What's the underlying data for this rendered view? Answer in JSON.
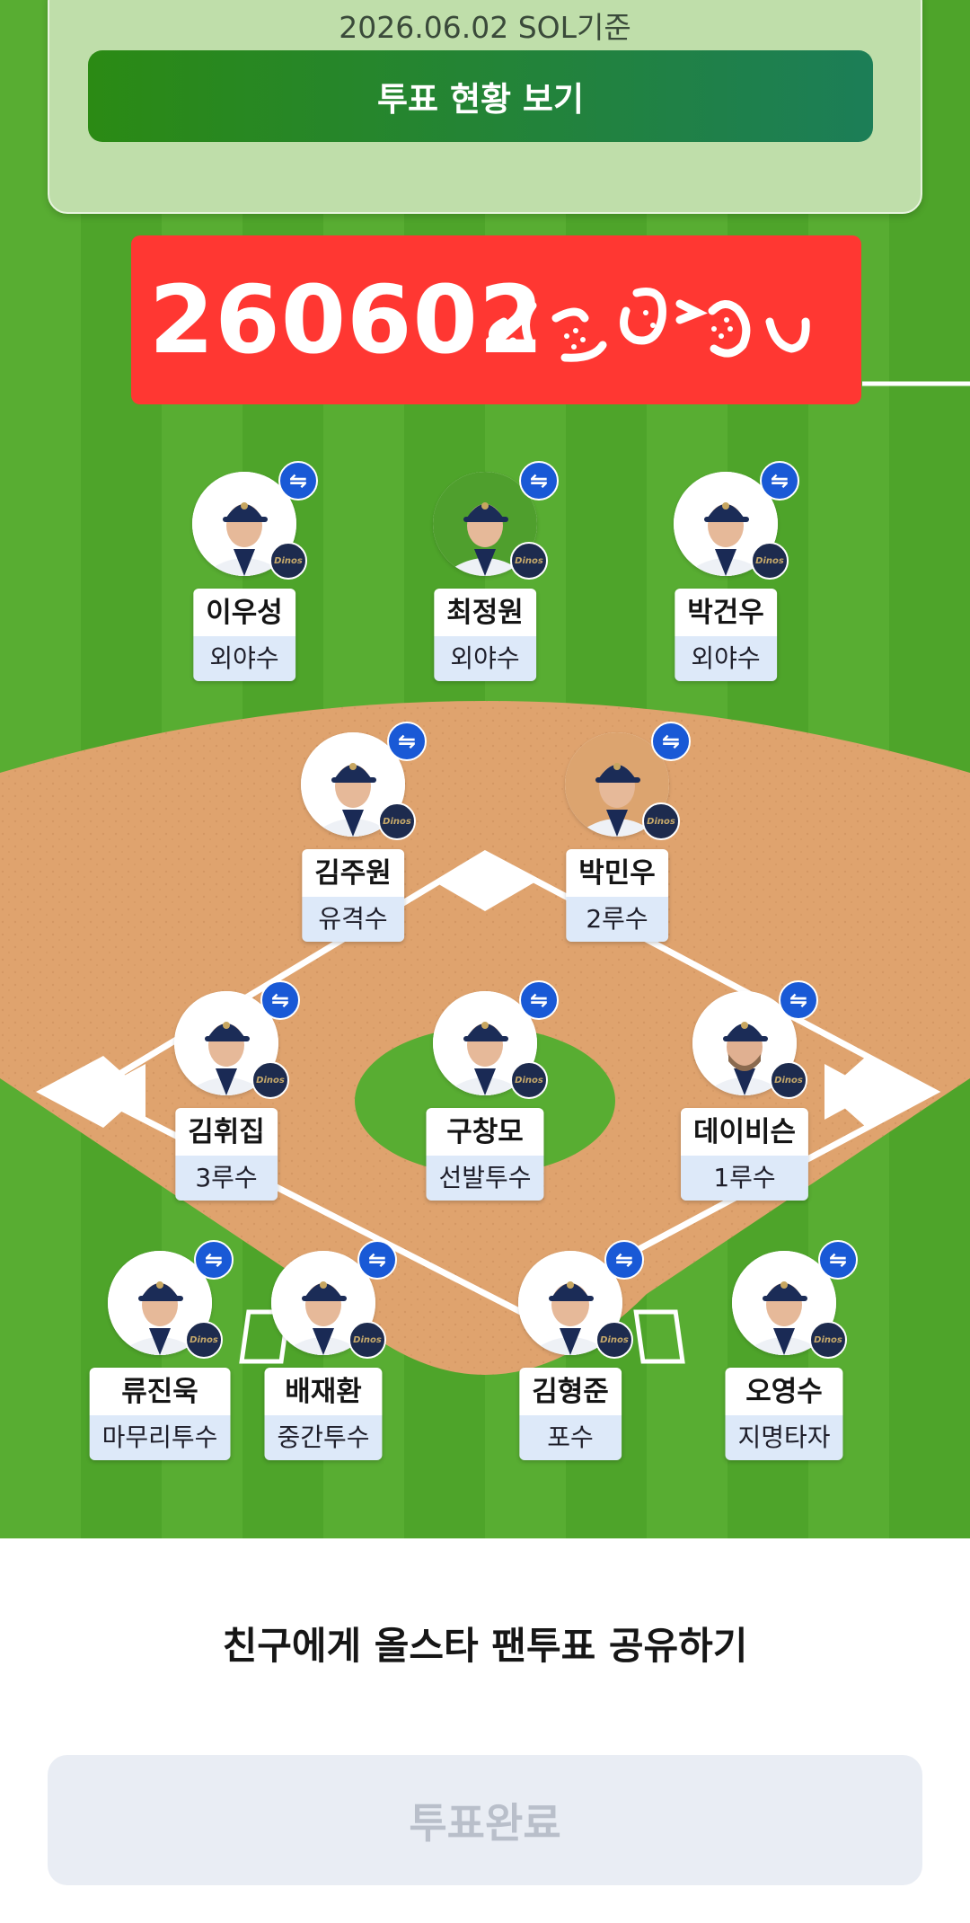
{
  "header": {
    "date_text": "2026.06.02 SOL기준",
    "vote_status_label": "투표 현황 보기"
  },
  "banner": {
    "number": "260602"
  },
  "lineup": [
    {
      "name": "이우성",
      "position": "외야수"
    },
    {
      "name": "최정원",
      "position": "외야수"
    },
    {
      "name": "박건우",
      "position": "외야수"
    },
    {
      "name": "김주원",
      "position": "유격수"
    },
    {
      "name": "박민우",
      "position": "2루수"
    },
    {
      "name": "김휘집",
      "position": "3루수"
    },
    {
      "name": "구창모",
      "position": "선발투수"
    },
    {
      "name": "데이비슨",
      "position": "1루수"
    },
    {
      "name": "류진욱",
      "position": "마무리투수"
    },
    {
      "name": "배재환",
      "position": "중간투수"
    },
    {
      "name": "김형준",
      "position": "포수"
    },
    {
      "name": "오영수",
      "position": "지명타자"
    }
  ],
  "icons": {
    "swap": "swap-icon",
    "team": "team-logo-icon",
    "swap_glyph": "⇋",
    "team_text": "Dinos"
  },
  "share": {
    "title": "친구에게 올스타 팬투표 공유하기"
  },
  "footer": {
    "vote_done_label": "투표완료"
  },
  "colors": {
    "grass": "#58ad32",
    "dirt": "#dfa36e",
    "banner_red": "#ff3732",
    "button_green": "#2b8a14",
    "swap_blue": "#1959d6",
    "position_bg": "#dde9f9"
  }
}
